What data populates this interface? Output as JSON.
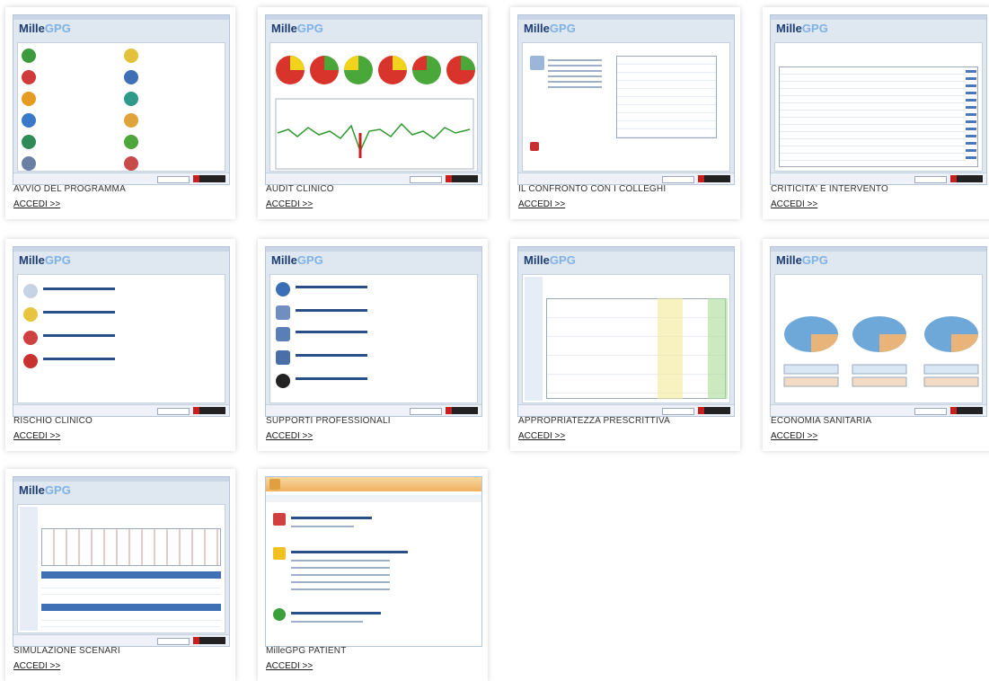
{
  "cards": [
    {
      "title": "AVVIO DEL PROGRAMMA",
      "link": "ACCEDI >>"
    },
    {
      "title": "AUDIT CLINICO",
      "link": "ACCEDI >>"
    },
    {
      "title": "IL CONFRONTO CON I COLLEGHI",
      "link": "ACCEDI >>"
    },
    {
      "title": "CRITICITA' E INTERVENTO",
      "link": "ACCEDI >>"
    },
    {
      "title": "RISCHIO CLINICO",
      "link": "ACCEDI >>"
    },
    {
      "title": "SUPPORTI PROFESSIONALI",
      "link": "ACCEDI >>"
    },
    {
      "title": "APPROPRIATEZZA PRESCRITTIVA",
      "link": "ACCEDI >>"
    },
    {
      "title": "ECONOMIA SANITARIA",
      "link": "ACCEDI >>"
    },
    {
      "title": "SIMULAZIONE SCENARI",
      "link": "ACCEDI >>"
    },
    {
      "title": "MilleGPG PATIENT",
      "link": "ACCEDI >>"
    }
  ],
  "logo": {
    "mille": "Mille",
    "gpg": "GPG"
  },
  "colors": {
    "accent": "#1d3d73",
    "border": "#b7c5d8"
  }
}
